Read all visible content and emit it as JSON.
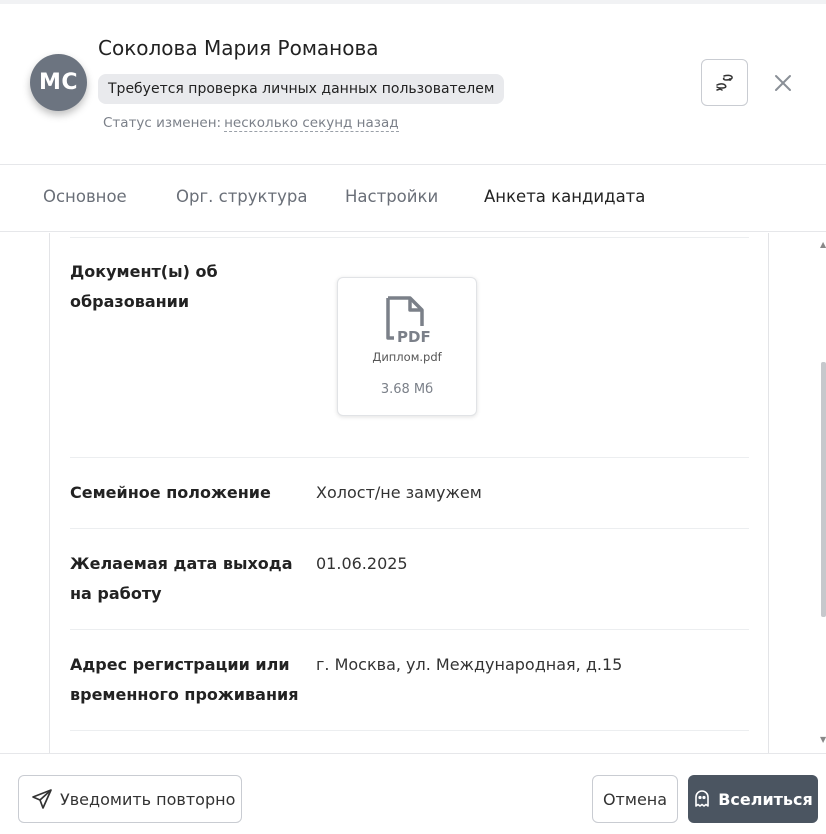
{
  "header": {
    "avatar_initials": "МС",
    "name": "Соколова Мария Романова",
    "badge": "Требуется проверка личных данных пользователем",
    "status_prefix": "Статус изменен:",
    "status_time": "несколько секунд назад"
  },
  "tabs": [
    {
      "label": "Основное"
    },
    {
      "label": "Орг. структура"
    },
    {
      "label": "Настройки"
    },
    {
      "label": "Анкета кандидата"
    }
  ],
  "form": {
    "education_label": "Документ(ы) об образовании",
    "file": {
      "name": "Диплом.pdf",
      "size": "3.68 Мб",
      "type_label": "PDF"
    },
    "marital_label": "Семейное положение",
    "marital_value": "Холост/не замужем",
    "start_date_label": "Желаемая дата выхода на работу",
    "start_date_value": "01.06.2025",
    "address_label": "Адрес регистрации или временного проживания",
    "address_value": "г. Москва, ул. Международная, д.15"
  },
  "footer": {
    "notify_label": "Уведомить повторно",
    "cancel_label": "Отмена",
    "move_in_label": "Вселиться"
  },
  "icons": {
    "header_action": "footprints-icon",
    "close": "close-icon",
    "notify": "send-icon",
    "move_in": "ghost-icon",
    "file": "pdf-file-icon"
  },
  "colors": {
    "avatar_bg": "#6c7480",
    "primary_button": "#4b5561",
    "badge_bg": "#e9eaed"
  }
}
